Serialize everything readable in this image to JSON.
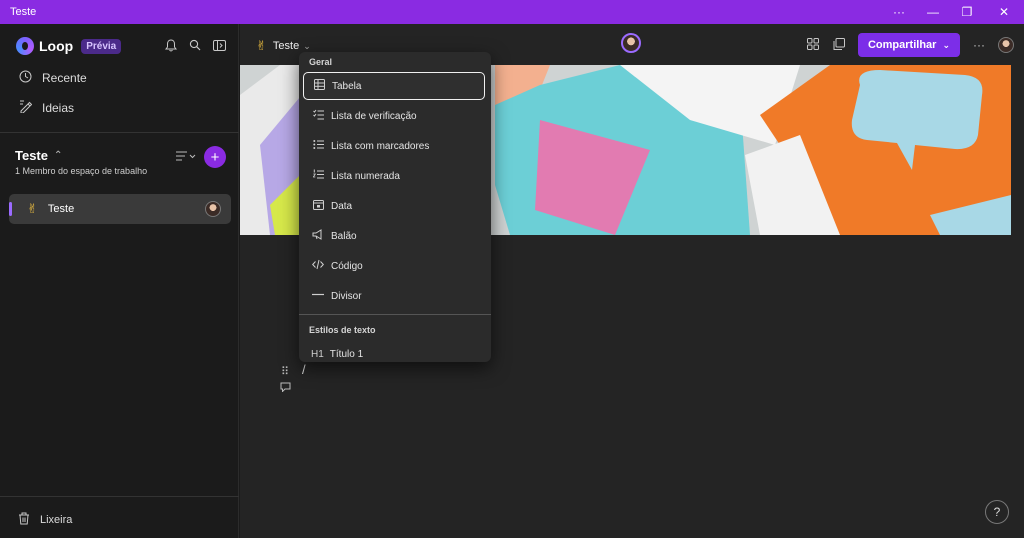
{
  "titlebar": {
    "title": "Teste",
    "more": "···",
    "minimize": "—",
    "restore": "❐",
    "close": "✕"
  },
  "sidebar": {
    "app_name": "Loop",
    "badge": "Prévia",
    "nav": [
      {
        "label": "Recente",
        "icon": "clock-icon"
      },
      {
        "label": "Ideias",
        "icon": "ideas-icon"
      }
    ],
    "workspace": {
      "name": "Teste",
      "members": "1 Membro do espaço de trabalho"
    },
    "pages": [
      {
        "label": "Teste",
        "emoji": "✌"
      }
    ],
    "trash_label": "Lixeira"
  },
  "header": {
    "doc_title": "Teste",
    "doc_emoji": "✌",
    "share_label": "Compartilhar"
  },
  "editor": {
    "slash": "/"
  },
  "command_menu": {
    "section_general": "Geral",
    "items": [
      {
        "label": "Tabela",
        "icon": "table-icon",
        "selected": true
      },
      {
        "label": "Lista de verificação",
        "icon": "checklist-icon"
      },
      {
        "label": "Lista com marcadores",
        "icon": "bullet-list-icon"
      },
      {
        "label": "Lista numerada",
        "icon": "numbered-list-icon"
      },
      {
        "label": "Data",
        "icon": "calendar-icon"
      },
      {
        "label": "Balão",
        "icon": "megaphone-icon"
      },
      {
        "label": "Código",
        "icon": "code-icon"
      },
      {
        "label": "Divisor",
        "icon": "divider-icon"
      }
    ],
    "section_text": "Estilos de texto",
    "text_items": [
      {
        "label": "Título 1",
        "icon_text": "H1"
      }
    ]
  },
  "help_label": "?",
  "colors": {
    "accent": "#8a2be2",
    "share": "#7c2ee8",
    "background": "#242424",
    "sidebar": "#1b1b1b"
  }
}
